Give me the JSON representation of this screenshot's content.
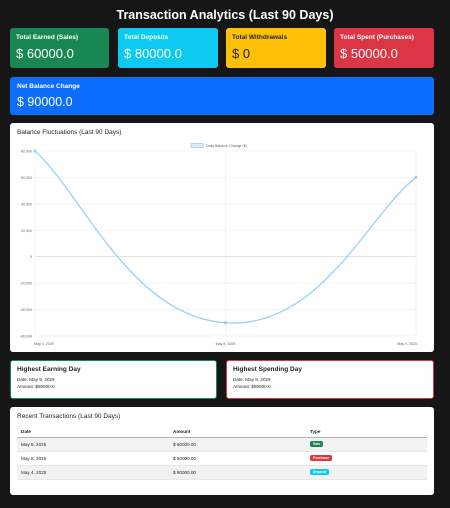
{
  "page_title": "Transaction Analytics (Last 90 Days)",
  "stats": [
    {
      "label": "Total Earned (Sales)",
      "value": "$ 60000.0",
      "color": "#198754",
      "text_color": "#ffffff"
    },
    {
      "label": "Total Deposits",
      "value": "$ 80000.0",
      "color": "#0dcaf0",
      "text_color": "#ffffff"
    },
    {
      "label": "Total Withdrawals",
      "value": "$ 0",
      "color": "#ffc107",
      "text_color": "#212529"
    },
    {
      "label": "Total Spent (Purchases)",
      "value": "$ 50000.0",
      "color": "#dc3545",
      "text_color": "#ffffff"
    }
  ],
  "net_balance": {
    "label": "Net Balance Change",
    "value": "$ 90000.0",
    "color": "#0d6efd"
  },
  "chart_title": "Balance Fluctuations (Last 90 Days)",
  "chart_data": {
    "type": "line",
    "x": [
      "May 4, 2025",
      "May 8, 2025",
      "May 9, 2025"
    ],
    "series": [
      {
        "name": "Daily Balance Change ($)",
        "values": [
          80000,
          -50000,
          60000
        ],
        "color": "#9ad0f5"
      }
    ],
    "ylim": [
      -60000,
      80000
    ],
    "yticks": [
      "80,000",
      "60,000",
      "40,000",
      "20,000",
      "0",
      "-20,000",
      "-40,000",
      "-60,000"
    ],
    "ytick_values": [
      80000,
      60000,
      40000,
      20000,
      0,
      -20000,
      -40000,
      -60000
    ],
    "grid": true,
    "legend_position": "top"
  },
  "highlights": {
    "earning": {
      "title": "Highest Earning Day",
      "date_line": "Date: May 9, 2025",
      "amount_line": "Amount: $60000.0",
      "border_color": "#198754"
    },
    "spending": {
      "title": "Highest Spending Day",
      "date_line": "Date: May 8, 2025",
      "amount_line": "Amount: $50000.0",
      "border_color": "#dc3545"
    }
  },
  "transactions": {
    "title": "Recent Transactions (Last 90 Days)",
    "columns": [
      "Date",
      "Amount",
      "Type"
    ],
    "rows": [
      {
        "date": "May 9, 2025",
        "amount": "$ 60000.00",
        "type": "Sale",
        "badge_color": "#198754",
        "badge_text_color": "#ffffff"
      },
      {
        "date": "May 8, 2025",
        "amount": "$ 50000.00",
        "type": "Purchase",
        "badge_color": "#dc3545",
        "badge_text_color": "#ffffff"
      },
      {
        "date": "May 4, 2025",
        "amount": "$ 80000.00",
        "type": "Deposit",
        "badge_color": "#0dcaf0",
        "badge_text_color": "#ffffff"
      }
    ]
  }
}
